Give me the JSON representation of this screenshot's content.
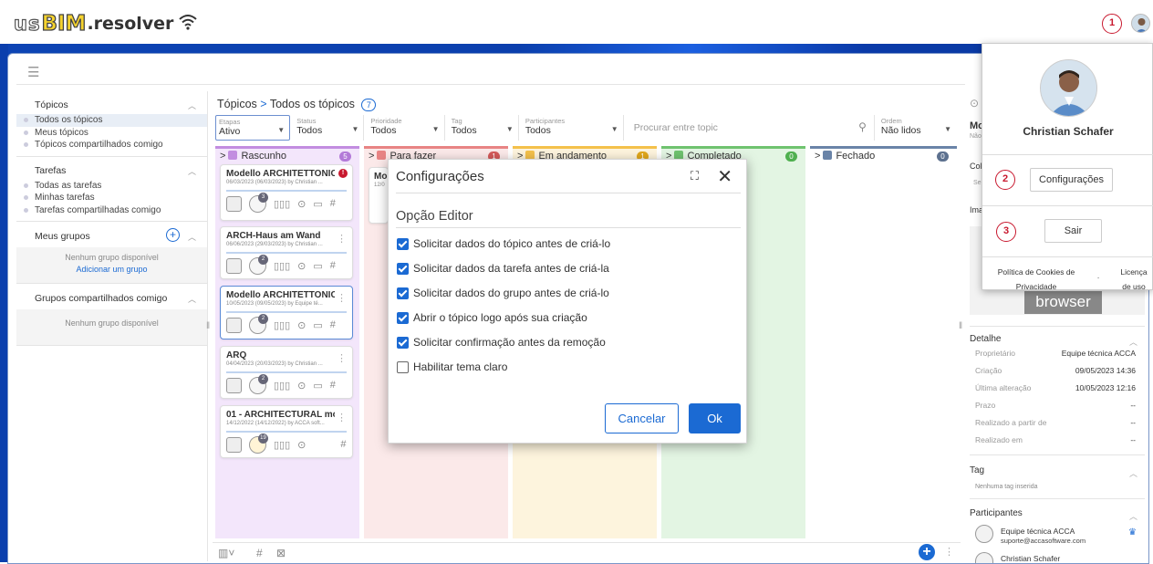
{
  "header": {
    "logo_us": "us",
    "logo_bim": "BIM",
    "logo_resolver": ".resolver",
    "badge": "1"
  },
  "sidebar": {
    "topics_title": "Tópicos",
    "topics": [
      "Todos os tópicos",
      "Meus tópicos",
      "Tópicos compartilhados comigo"
    ],
    "tasks_title": "Tarefas",
    "tasks": [
      "Todas as tarefas",
      "Minhas tarefas",
      "Tarefas compartilhadas comigo"
    ],
    "groups_title": "Meus grupos",
    "groups_empty": "Nenhum grupo disponível",
    "groups_add": "Adicionar um grupo",
    "shared_title": "Grupos compartilhados comigo",
    "shared_empty": "Nenhum grupo disponível"
  },
  "main": {
    "crumb_root": "Tópicos",
    "crumb_current": "Todos os tópicos",
    "crumb_count": "7",
    "filters": {
      "etapas_label": "Etapas",
      "etapas_value": "Ativo",
      "status_label": "Status",
      "status_value": "Todos",
      "prioridade_label": "Prioridade",
      "prioridade_value": "Todos",
      "tag_label": "Tag",
      "tag_value": "Todos",
      "participantes_label": "Participantes",
      "participantes_value": "Todos",
      "search_placeholder": "Procurar entre topic",
      "ordem_label": "Ordem",
      "ordem_value": "Não lidos"
    },
    "columns": [
      {
        "title": "Rascunho",
        "count": "5",
        "color": "#c28de0",
        "bg": "#f3e6fb",
        "badge": "#b37ad8"
      },
      {
        "title": "Para fazer",
        "count": "1",
        "color": "#e88484",
        "bg": "#fbe9e9",
        "badge": "#d45a5a"
      },
      {
        "title": "Em andamento",
        "count": "1",
        "color": "#f4c14b",
        "bg": "#fdf4dd",
        "badge": "#e2a81c"
      },
      {
        "title": "Completado",
        "count": "0",
        "color": "#6fc36f",
        "bg": "#e3f5e3",
        "badge": "#4fb04f"
      },
      {
        "title": "Fechado",
        "count": "0",
        "color": "#6a84a8",
        "bg": "#ffffff",
        "badge": "#5d718f"
      }
    ],
    "cards": [
      {
        "title": "Modello ARCHITETTONIC...",
        "sub": "06/03/2023 (06/03/2023) by Christian ...",
        "alert": "!",
        "num": "3"
      },
      {
        "title": "ARCH-Haus am Wand",
        "sub": "06/06/2023 (29/03/2023) by Christian ...",
        "num": "2"
      },
      {
        "title": "Modello ARCHITETTONIC...",
        "sub": "10/05/2023 (09/05/2023) by Equipe té...",
        "num": "2"
      },
      {
        "title": "ARQ",
        "sub": "04/04/2023 (20/03/2023) by Christian ...",
        "num": "2"
      },
      {
        "title": "01 - ARCHITECTURAL mo...",
        "sub": "14/12/2022 (14/12/2022) by ACCA soft...",
        "num": "19"
      }
    ],
    "col2_card_title": "Mo",
    "col2_card_sub": "12/0"
  },
  "dialog": {
    "title": "Configurações",
    "section": "Opção Editor",
    "options": [
      {
        "label": "Solicitar dados do tópico antes de criá-lo",
        "checked": true
      },
      {
        "label": "Solicitar dados da tarefa antes de criá-la",
        "checked": true
      },
      {
        "label": "Solicitar dados do grupo antes de criá-lo",
        "checked": true
      },
      {
        "label": "Abrir o tópico logo após sua criação",
        "checked": true
      },
      {
        "label": "Solicitar confirmação antes da remoção",
        "checked": true
      },
      {
        "label": "Habilitar tema claro",
        "checked": false
      }
    ],
    "cancel": "Cancelar",
    "ok": "Ok"
  },
  "profile": {
    "name": "Christian Schafer",
    "badge2": "2",
    "config_btn": "Configurações",
    "badge3": "3",
    "logout_btn": "Sair",
    "cookies": "Política de Cookies de Privacidade",
    "dot": ".",
    "license": "Licença de uso"
  },
  "right_panel": {
    "title_prefix": "Mo",
    "title_sub": "Não",
    "col_label": "Col",
    "se_label": "Se",
    "ima_label": "Ima",
    "browser": "browser",
    "detail_title": "Detalhe",
    "details": [
      {
        "k": "Proprietário",
        "v": "Equipe técnica ACCA"
      },
      {
        "k": "Criação",
        "v": "09/05/2023 14:36"
      },
      {
        "k": "Última alteração",
        "v": "10/05/2023 12:16"
      },
      {
        "k": "Prazo",
        "v": "--"
      },
      {
        "k": "Realizado a partir de",
        "v": "--"
      },
      {
        "k": "Realizado em",
        "v": "--"
      }
    ],
    "tag_title": "Tag",
    "tag_empty": "Nenhuma tag inserida",
    "participants_title": "Participantes",
    "p1_name": "Equipe técnica ACCA",
    "p1_email": "suporte@accasoftware.com",
    "p2_name": "Christian Schafer"
  }
}
